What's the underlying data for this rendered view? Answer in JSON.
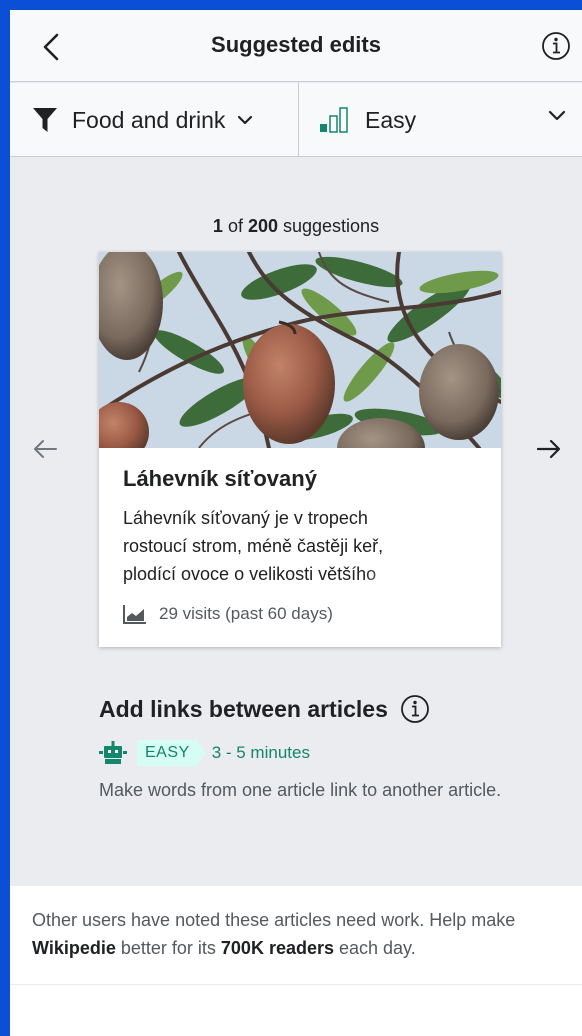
{
  "header": {
    "title": "Suggested edits",
    "back_icon": "chevron-left-icon",
    "info_icon": "info-icon"
  },
  "filters": {
    "topic": {
      "label": "Food and drink",
      "icon": "funnel-icon"
    },
    "difficulty": {
      "label": "Easy",
      "icon": "difficulty-bars-icon",
      "level": "1 of 3 bars highlighted"
    }
  },
  "counter": {
    "current": "1",
    "of": " of ",
    "total": "200",
    "suffix": " suggestions"
  },
  "card": {
    "title": "Láhevník síťovaný",
    "extract": "Láhevník síťovaný je v tropech rostoucí strom, méně častěji keř, plodící ovoce o velikosti většího",
    "visits": "29 visits (past 60 days)",
    "image": "custard apple fruits on tree branches"
  },
  "task": {
    "title": "Add links between articles",
    "badge": "EASY",
    "duration": "3 - 5 minutes",
    "description": "Make words from one article link to another article."
  },
  "footer": {
    "part1": "Other users have noted these articles need work. Help make ",
    "wiki": "Wikipedie",
    "part2": " better for its ",
    "readers": "700K readers",
    "part3": " each day."
  },
  "colors": {
    "accent_green": "#14866d",
    "badge_bg": "#d5fdf4",
    "page_bg": "#eaecf0",
    "outer_border": "#0b4fd6"
  }
}
